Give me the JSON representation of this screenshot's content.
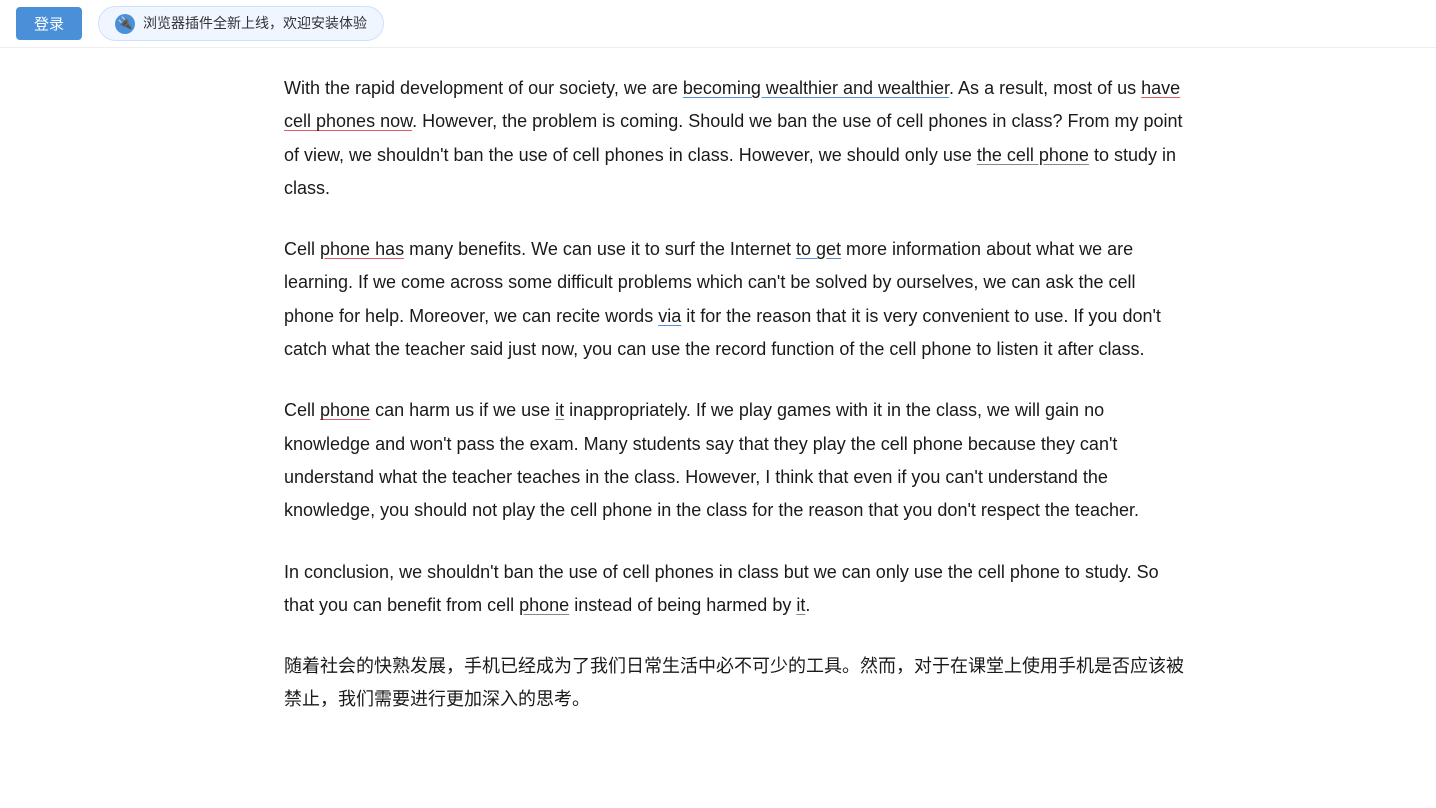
{
  "topbar": {
    "login_label": "登录",
    "plugin_banner": "浏览器插件全新上线，欢迎安装体验"
  },
  "article": {
    "paragraph1": "With the rapid development of our society, we are becoming wealthier and wealthier. As a result, most of us have cell phones now. However, the problem is coming. Should we ban the use of cell phones in class? From my point of view, we shouldn't ban the use of cell phones in class. However, we should only use the cell phone to study in class.",
    "paragraph2": "Cell phone has many benefits. We can use it to surf the Internet to get more information about what we are learning. If we come across some difficult problems which can't be solved by ourselves, we can ask the cell phone for help. Moreover, we can recite words via it for the reason that it is very convenient to use. If you don't catch what the teacher said just now, you can use the record function of the cell phone to listen it after class.",
    "paragraph3": "Cell phone can harm us if we use it inappropriately. If we play games with it in the class, we will gain no knowledge and won't pass the exam. Many students say that they play the cell phone because they can't understand what the teacher teaches in the class. However, I think that even if you can't understand the knowledge, you should not play the cell phone in the class for the reason that you don't respect the teacher.",
    "paragraph4": "In conclusion, we shouldn't ban the use of cell phones in class but we can only use the cell phone to study. So that you can benefit from cell phone instead of being harmed by it.",
    "paragraph5_cn": "随着社会的快熟发展，手机已经成为了我们日常生活中必不可少的工具。然而，对于在课堂上使用手机是否应该被禁止，我们需要进行更加深入的思考。"
  }
}
